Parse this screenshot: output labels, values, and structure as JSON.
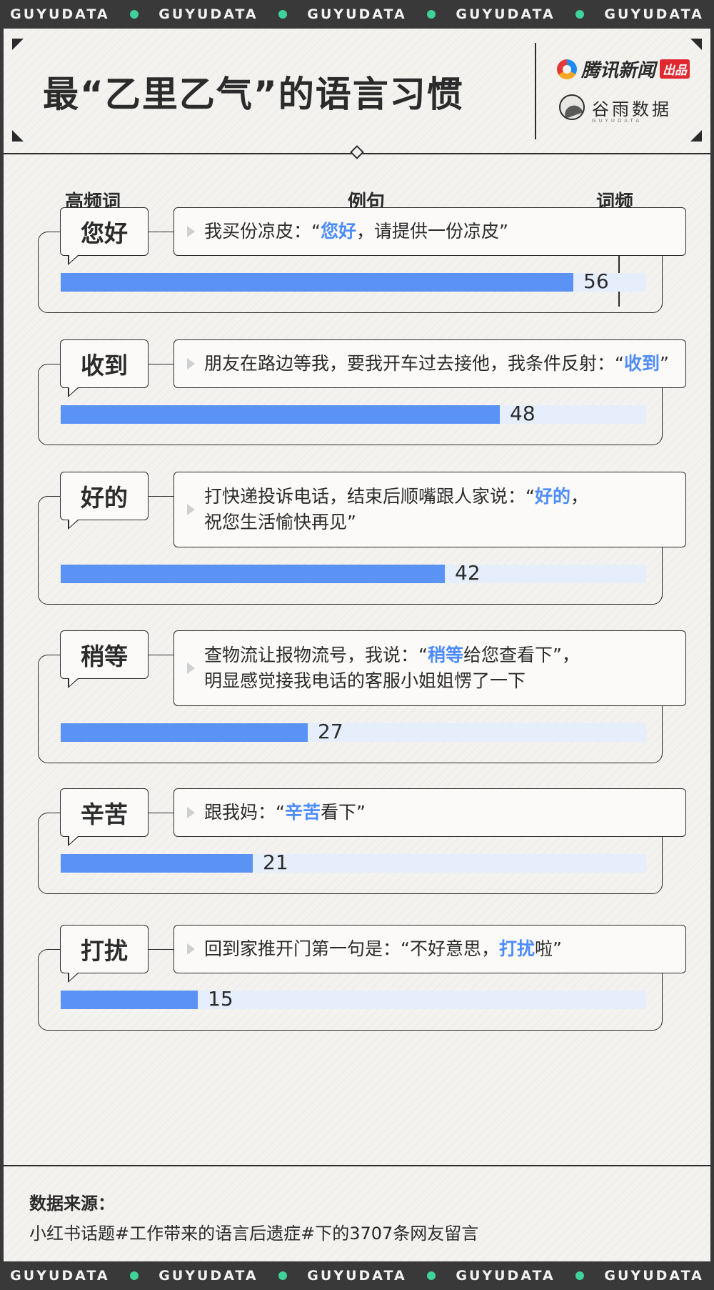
{
  "ticker": [
    "GUYUDATA",
    "GUYUDATA",
    "GUYUDATA",
    "GUYUDATA",
    "GUYUDATA"
  ],
  "header": {
    "title": "最“乙里乙气”的语言习惯",
    "logo_tencent": "腾讯新闻",
    "logo_tencent_badge": "出品",
    "logo_guyu": "谷雨数据",
    "logo_guyu_sub": "GUYUDATA"
  },
  "columns": {
    "word": "高频词",
    "example": "例句",
    "freq": "词频"
  },
  "colors": {
    "bar": "#5b93f5",
    "track": "#e6eefb",
    "highlight": "#4d8cff",
    "dot": "#3fd39a"
  },
  "source": {
    "label": "数据来源：",
    "text": "小红书话题#工作带来的语言后遗症#下的3707条网友留言"
  },
  "chart_data": {
    "type": "bar",
    "orientation": "horizontal",
    "title": "最“乙里乙气”的语言习惯",
    "xlim": [
      0,
      64
    ],
    "categories": [
      "您好",
      "收到",
      "好的",
      "稍等",
      "辛苦",
      "打扰"
    ],
    "values": [
      56,
      48,
      42,
      27,
      21,
      15
    ],
    "rows": [
      {
        "word": "您好",
        "value": 56,
        "sentence": [
          [
            {
              "t": "我买份凉皮：“"
            },
            {
              "t": "您好",
              "hl": true
            },
            {
              "t": "，请提供一份凉皮”"
            }
          ]
        ]
      },
      {
        "word": "收到",
        "value": 48,
        "sentence": [
          [
            {
              "t": "朋友在路边等我，要我开车过去接他，我条件反射：“"
            },
            {
              "t": "收到",
              "hl": true
            },
            {
              "t": "”"
            }
          ]
        ]
      },
      {
        "word": "好的",
        "value": 42,
        "sentence": [
          [
            {
              "t": "打快递投诉电话，结束后顺嘴跟人家说：“"
            },
            {
              "t": "好的",
              "hl": true
            },
            {
              "t": "，"
            }
          ],
          [
            {
              "t": "祝您生活愉快再见”"
            }
          ]
        ]
      },
      {
        "word": "稍等",
        "value": 27,
        "sentence": [
          [
            {
              "t": "查物流让报物流号，我说：“"
            },
            {
              "t": "稍等",
              "hl": true
            },
            {
              "t": "给您查看下”，"
            }
          ],
          [
            {
              "t": "明显感觉接我电话的客服小姐姐愣了一下"
            }
          ]
        ]
      },
      {
        "word": "辛苦",
        "value": 21,
        "sentence": [
          [
            {
              "t": "跟我妈：“"
            },
            {
              "t": "辛苦",
              "hl": true
            },
            {
              "t": "看下”"
            }
          ]
        ]
      },
      {
        "word": "打扰",
        "value": 15,
        "sentence": [
          [
            {
              "t": "回到家推开门第一句是：“不好意思，"
            },
            {
              "t": "打扰",
              "hl": true
            },
            {
              "t": "啦”"
            }
          ]
        ]
      }
    ]
  }
}
